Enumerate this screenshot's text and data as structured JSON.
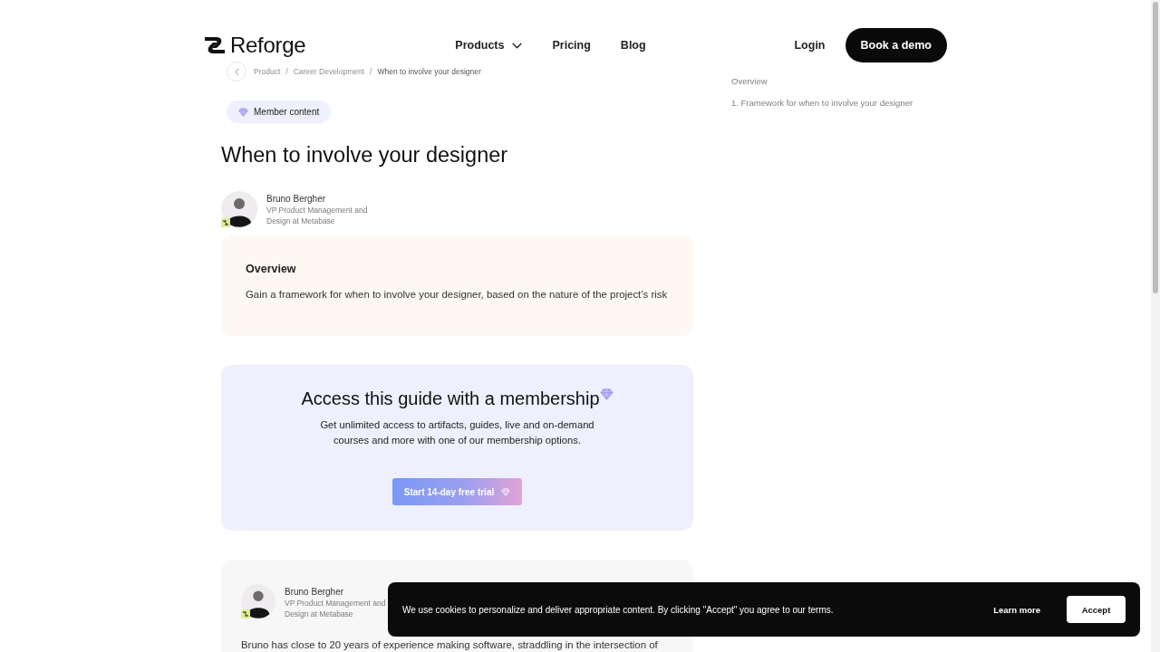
{
  "header": {
    "logo": "Reforge",
    "nav": [
      {
        "label": "Products",
        "kind": "dropdown"
      },
      {
        "label": "Pricing",
        "kind": "link"
      },
      {
        "label": "Blog",
        "kind": "link"
      }
    ],
    "login": "Login",
    "cta": "Book a demo"
  },
  "breadcrumb": [
    {
      "kind": "link",
      "text": "Product"
    },
    {
      "kind": "separator",
      "text": "/"
    },
    {
      "kind": "link",
      "text": "Career Development"
    },
    {
      "kind": "separator",
      "text": "/"
    },
    {
      "kind": "current",
      "text": "When to involve your designer"
    }
  ],
  "badge": "Member content",
  "article": {
    "title": "When to involve your designer",
    "author": {
      "name": "Bruno Bergher",
      "role": "VP Product Management and Design at Metabase"
    }
  },
  "overview": {
    "heading": "Overview",
    "text": "Gain a framework for when to involve your designer, based on the nature of the project’s risk"
  },
  "membership": {
    "heading": "Access this guide with a membership",
    "text": "Get unlimited access to artifacts, guides, live and on-demand courses and more with one of our membership options.",
    "button": "Start 14-day free trial"
  },
  "bio": {
    "author": {
      "name": "Bruno Bergher",
      "role": "VP Product Management and Design at Metabase"
    },
    "text": "Bruno has close to 20 years of experience making software, straddling in the intersection of"
  },
  "toc": [
    {
      "label": "Overview"
    },
    {
      "label": "1. Framework for when to involve your designer"
    }
  ],
  "cookie_banner": {
    "text": "We use cookies to personalize and deliver appropriate content. By clicking \"Accept\" you agree to our terms.",
    "learn_more": "Learn more",
    "accept": "Accept"
  }
}
